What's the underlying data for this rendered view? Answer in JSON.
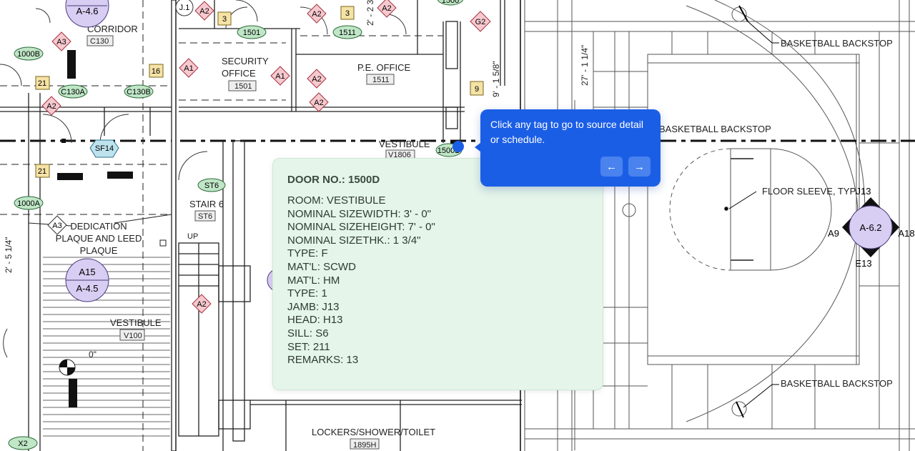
{
  "drawing": {
    "room_labels": {
      "corridor": "CORRIDOR",
      "corridor_num": "C130",
      "security_office": "SECURITY\nOFFICE",
      "security_office_num": "1501",
      "pe_office": "P.E. OFFICE",
      "pe_office_num": "1511",
      "vestibule_top": "VESTIBULE",
      "vestibule_top_num": "V1806",
      "stair": "STAIR 6",
      "stair_num": "ST6",
      "up": "UP",
      "dedication": "DEDICATION\nPLAQUE AND LEED\nPLAQUE",
      "vestibule_bottom": "VESTIBULE",
      "vestibule_bottom_num": "V100",
      "lockers": "LOCKERS/SHOWER/TOILET",
      "lockers_num": "1895H"
    },
    "callouts": {
      "backstop_top": "BASKETBALL BACKSTOP",
      "backstop_mid": "BASKETBALL BACKSTOP",
      "backstop_bottom": "BASKETBALL BACKSTOP",
      "floor_sleeve": "FLOOR SLEEVE, TYP."
    },
    "dimensions": {
      "d1": "27' - 1 1/4\"",
      "d2": "9' - 1 5/8\"",
      "d3": "2' - 5 1/4\"",
      "d4": "2' - 2 3",
      "d5": "0\""
    },
    "tags": {
      "door_1501": "1501",
      "door_1511": "1511",
      "door_1000B": "1000B",
      "door_C130A": "C130A",
      "door_C130B": "C130B",
      "door_1000A": "1000A",
      "door_ST6": "ST6",
      "door_1500D": "1500D",
      "door_top": "1500",
      "door_X2": "X2",
      "hw_A2_1": "A2",
      "hw_A2_2": "A2",
      "hw_A2_3": "A2",
      "hw_A2_4": "A2",
      "hw_A2_5": "A2",
      "hw_A2_6": "A2",
      "hw_A2_7": "A2",
      "hw_A1_1": "A1",
      "hw_A1_2": "A1",
      "hw_A3_1": "A3",
      "hw_A3_2": "A3",
      "hw_G2": "G2",
      "sq_3a": "3",
      "sq_3b": "3",
      "sq_16": "16",
      "sq_21a": "21",
      "sq_21b": "21",
      "sq_9": "9",
      "hex_SF14": "SF14",
      "elev_A46": "A-4.6",
      "elev_A15_top": "A15",
      "elev_A15_bot": "A-4.5",
      "detail_J1": "J.1",
      "elev_A62": "A-6.2",
      "elev_J13": "J13",
      "elev_A9": "A9",
      "elev_A18": "A18",
      "elev_E13": "E13"
    }
  },
  "popup": {
    "title": "DOOR NO.: 1500D",
    "fields": [
      "ROOM: VESTIBULE",
      "NOMINAL SIZEWIDTH: 3' - 0\"",
      "NOMINAL SIZEHEIGHT: 7' - 0\"",
      "NOMINAL SIZETHK.: 1 3/4\"",
      "TYPE: F",
      "MAT'L: SCWD",
      "MAT'L: HM",
      "TYPE: 1",
      "JAMB: J13",
      "HEAD: H13",
      "SILL: S6",
      "SET: 211",
      "REMARKS: 13"
    ]
  },
  "tour": {
    "text": "Click any tag to go to source detail or schedule.",
    "prev_icon": "arrow-left-icon",
    "next_icon": "arrow-right-icon",
    "prev_glyph": "←",
    "next_glyph": "→"
  },
  "colors": {
    "tour_accent": "#1b5ee6",
    "popup_bg": "#e5f5e9",
    "door_tag": "#bfe6c6",
    "hardware_tag": "#f6c9cf",
    "number_tag": "#f5e3a6",
    "elevation_tag": "#d8cdf2",
    "hex_tag": "#bde3ef"
  }
}
